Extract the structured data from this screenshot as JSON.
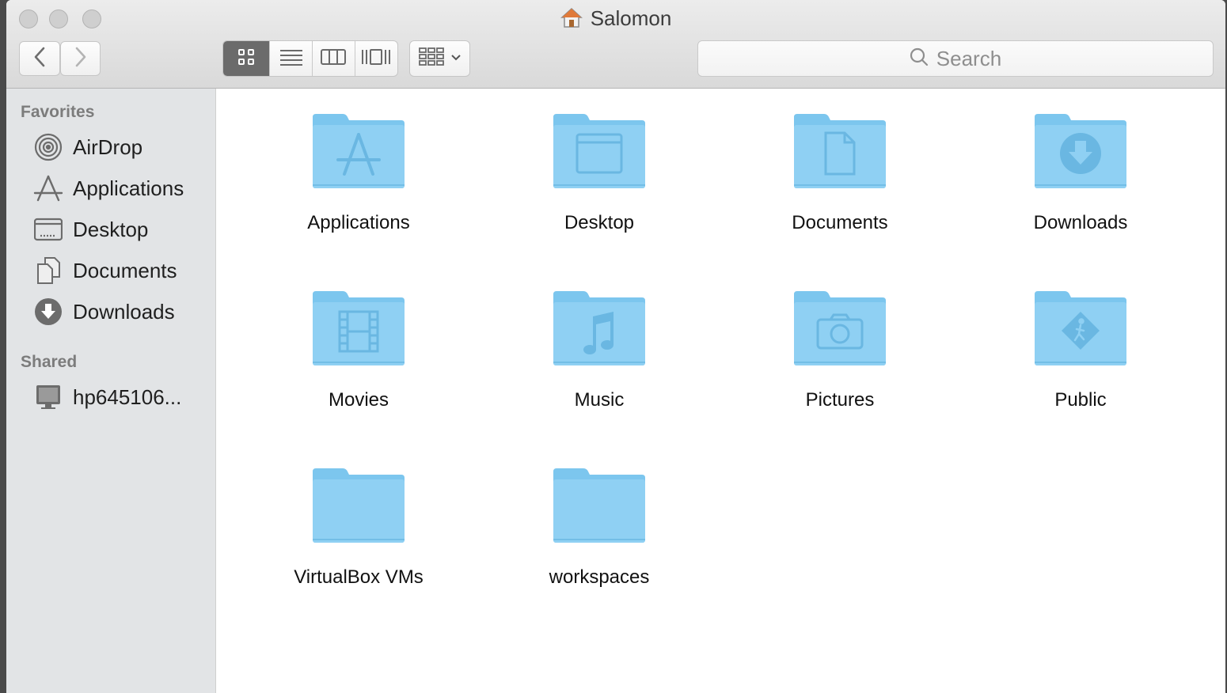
{
  "window": {
    "title": "Salomon"
  },
  "toolbar": {
    "back_icon": "chevron-left-icon",
    "forward_icon": "chevron-right-icon",
    "view_modes": [
      "icon-view",
      "list-view",
      "column-view",
      "cover-flow-view"
    ],
    "active_view": "icon-view",
    "arrange_icon": "arrange-grid-icon",
    "search_placeholder": "Search"
  },
  "sidebar": {
    "favorites_header": "Favorites",
    "favorites": [
      {
        "label": "AirDrop",
        "icon": "airdrop-icon"
      },
      {
        "label": "Applications",
        "icon": "applications-icon"
      },
      {
        "label": "Desktop",
        "icon": "desktop-icon"
      },
      {
        "label": "Documents",
        "icon": "documents-icon"
      },
      {
        "label": "Downloads",
        "icon": "downloads-icon"
      }
    ],
    "shared_header": "Shared",
    "shared": [
      {
        "label": "hp645106...",
        "icon": "computer-icon"
      }
    ]
  },
  "folders": [
    {
      "name": "Applications",
      "icon": "applications-folder-icon"
    },
    {
      "name": "Desktop",
      "icon": "desktop-folder-icon"
    },
    {
      "name": "Documents",
      "icon": "documents-folder-icon"
    },
    {
      "name": "Downloads",
      "icon": "downloads-folder-icon"
    },
    {
      "name": "Movies",
      "icon": "movies-folder-icon"
    },
    {
      "name": "Music",
      "icon": "music-folder-icon"
    },
    {
      "name": "Pictures",
      "icon": "pictures-folder-icon"
    },
    {
      "name": "Public",
      "icon": "public-folder-icon"
    },
    {
      "name": "VirtualBox VMs",
      "icon": "folder-icon"
    },
    {
      "name": "workspaces",
      "icon": "folder-icon"
    }
  ],
  "colors": {
    "folder": "#8fd0f3",
    "folder_tab": "#7cc6ee",
    "folder_glyph": "#6ab7e2"
  }
}
